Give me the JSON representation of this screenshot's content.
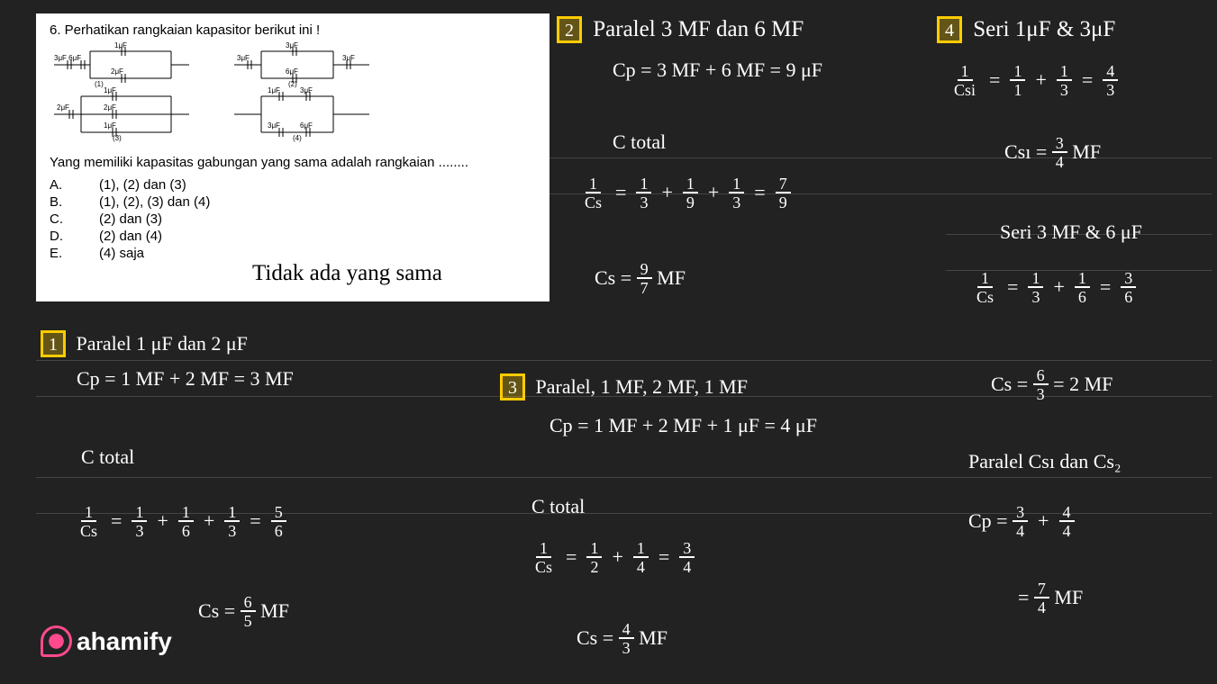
{
  "problem": {
    "title": "6. Perhatikan rangkaian kapasitor berikut ini !",
    "question": "Yang memiliki kapasitas gabungan yang sama adalah rangkaian ........",
    "circuit1": {
      "c1": "3μF 6μF",
      "c2": "1μF",
      "c3": "2μF",
      "c4": "1μF",
      "c5": "2μF",
      "c6": "2μF",
      "c7": "1μF",
      "num": "(1)",
      "num2": "(3)"
    },
    "circuit2": {
      "c1": "3μF",
      "c2": "3μF",
      "c3": "3μF",
      "c4": "6μF",
      "c5": "1μF",
      "c6": "3μF",
      "c7": "3μF",
      "c8": "6μF",
      "num": "(2)",
      "num2": "(4)"
    },
    "options": {
      "A": {
        "letter": "A.",
        "text": "(1), (2) dan (3)"
      },
      "B": {
        "letter": "B.",
        "text": "(1), (2), (3) dan (4)"
      },
      "C": {
        "letter": "C.",
        "text": "(2) dan (3)"
      },
      "D": {
        "letter": "D.",
        "text": "(2) dan (4)"
      },
      "E": {
        "letter": "E.",
        "text": "(4) saja"
      }
    }
  },
  "annotation": {
    "no_same": "Tidak ada yang sama"
  },
  "solution1": {
    "box_num": "1",
    "line1": "Paralel 1 μF dan 2 μF",
    "line2": "Cp = 1 MF + 2 MF = 3 MF",
    "line3": "C total",
    "eq_left": "1",
    "eq_cs": "Cs",
    "eq_3": "3",
    "eq_6": "6",
    "eq_1": "1",
    "eq_5": "5",
    "result": "Cs =",
    "result_num": "6",
    "result_den": "5",
    "result_unit": "MF"
  },
  "solution2": {
    "box_num": "2",
    "line1": "Paralel 3 MF dan 6 MF",
    "line2": "Cp = 3 MF + 6 MF = 9 μF",
    "line3": "C total",
    "eq_left": "1",
    "eq_cs": "Cs",
    "eq_3": "3",
    "eq_9": "9",
    "eq_7": "7",
    "result": "Cs =",
    "result_num": "9",
    "result_den": "7",
    "result_unit": "MF"
  },
  "solution3": {
    "box_num": "3",
    "line1": "Paralel, 1 MF, 2 MF, 1 MF",
    "line2": "Cp = 1 MF + 2 MF + 1 μF = 4 μF",
    "line3": "C total",
    "eq_left": "1",
    "eq_cs": "Cs",
    "eq_2": "2",
    "eq_4": "4",
    "eq_3": "3",
    "result": "Cs =",
    "result_num": "4",
    "result_den": "3",
    "result_unit": "MF"
  },
  "solution4": {
    "box_num": "4",
    "line1": "Seri 1μF & 3μF",
    "eq_csi": "Csi",
    "eq_1": "1",
    "eq_3": "3",
    "eq_4": "4",
    "csi_result": "Csı =",
    "csi_num": "3",
    "csi_den": "4",
    "csi_unit": "MF",
    "line2": "Seri 3 MF & 6 μF",
    "eq_cs": "Cs",
    "eq_6": "6",
    "cs2_num": "6",
    "cs2_den": "3",
    "cs2_result": "Cs =",
    "cs2_eq": "= 2 MF",
    "line3": "Paralel Csı dan Cs₂",
    "cp_eq": "Cp =",
    "cp_3": "3",
    "cp_4a": "4",
    "cp_4b": "4",
    "final_eq": "=",
    "final_num": "7",
    "final_den": "4",
    "final_unit": "MF"
  },
  "logo": "ahamify"
}
